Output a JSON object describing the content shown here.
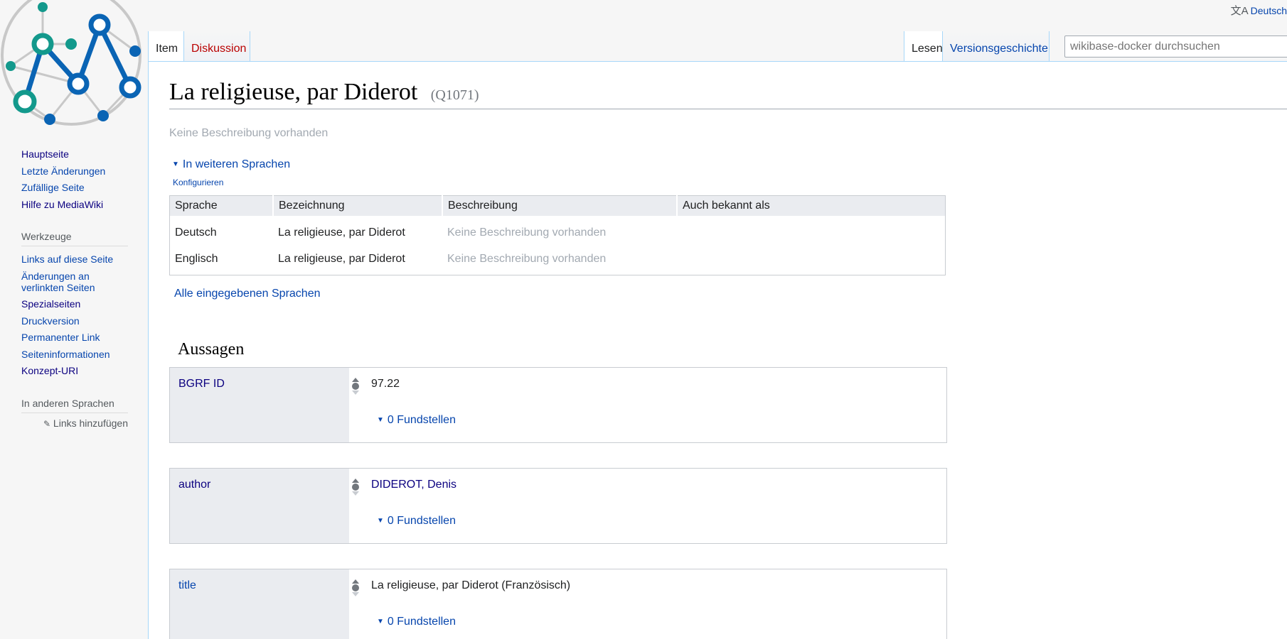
{
  "ui": {
    "language_label": "Deutsch",
    "search_placeholder": "wikibase-docker durchsuchen"
  },
  "tabs": {
    "item": "Item",
    "discussion": "Diskussion",
    "read": "Lesen",
    "history": "Versionsgeschichte"
  },
  "sidebar": {
    "navigation": [
      {
        "label": "Hauptseite"
      },
      {
        "label": "Letzte Änderungen"
      },
      {
        "label": "Zufällige Seite"
      },
      {
        "label": "Hilfe zu MediaWiki"
      }
    ],
    "tools_heading": "Werkzeuge",
    "tools": [
      {
        "label": "Links auf diese Seite"
      },
      {
        "label": "Änderungen an verlinkten Seiten"
      },
      {
        "label": "Spezialseiten"
      },
      {
        "label": "Druckversion"
      },
      {
        "label": "Permanenter Link"
      },
      {
        "label": "Seiteninformationen"
      },
      {
        "label": "Konzept-URI"
      }
    ],
    "languages_heading": "In anderen Sprachen",
    "add_links": "Links hinzufügen"
  },
  "entity": {
    "label": "La religieuse, par Diderot",
    "id": "(Q1071)",
    "description": "Keine Beschreibung vorhanden"
  },
  "languages": {
    "toggle": "In weiteren Sprachen",
    "configure": "Konfigurieren",
    "headers": {
      "language": "Sprache",
      "label": "Bezeichnung",
      "description": "Beschreibung",
      "aliases": "Auch bekannt als"
    },
    "rows": [
      {
        "language": "Deutsch",
        "label": "La religieuse, par Diderot",
        "description": "Keine Beschreibung vorhanden",
        "aliases": ""
      },
      {
        "language": "Englisch",
        "label": "La religieuse, par Diderot",
        "description": "Keine Beschreibung vorhanden",
        "aliases": ""
      }
    ],
    "all_languages": "Alle eingegebenen Sprachen"
  },
  "statements": {
    "heading": "Aussagen",
    "items": [
      {
        "property": "BGRF ID",
        "value": "97.22",
        "references": "0 Fundstellen"
      },
      {
        "property": "author",
        "value": "DIDEROT, Denis",
        "references": "0 Fundstellen"
      },
      {
        "property": "title",
        "value": "La religieuse, par Diderot (Französisch)",
        "references": "0 Fundstellen"
      }
    ]
  }
}
